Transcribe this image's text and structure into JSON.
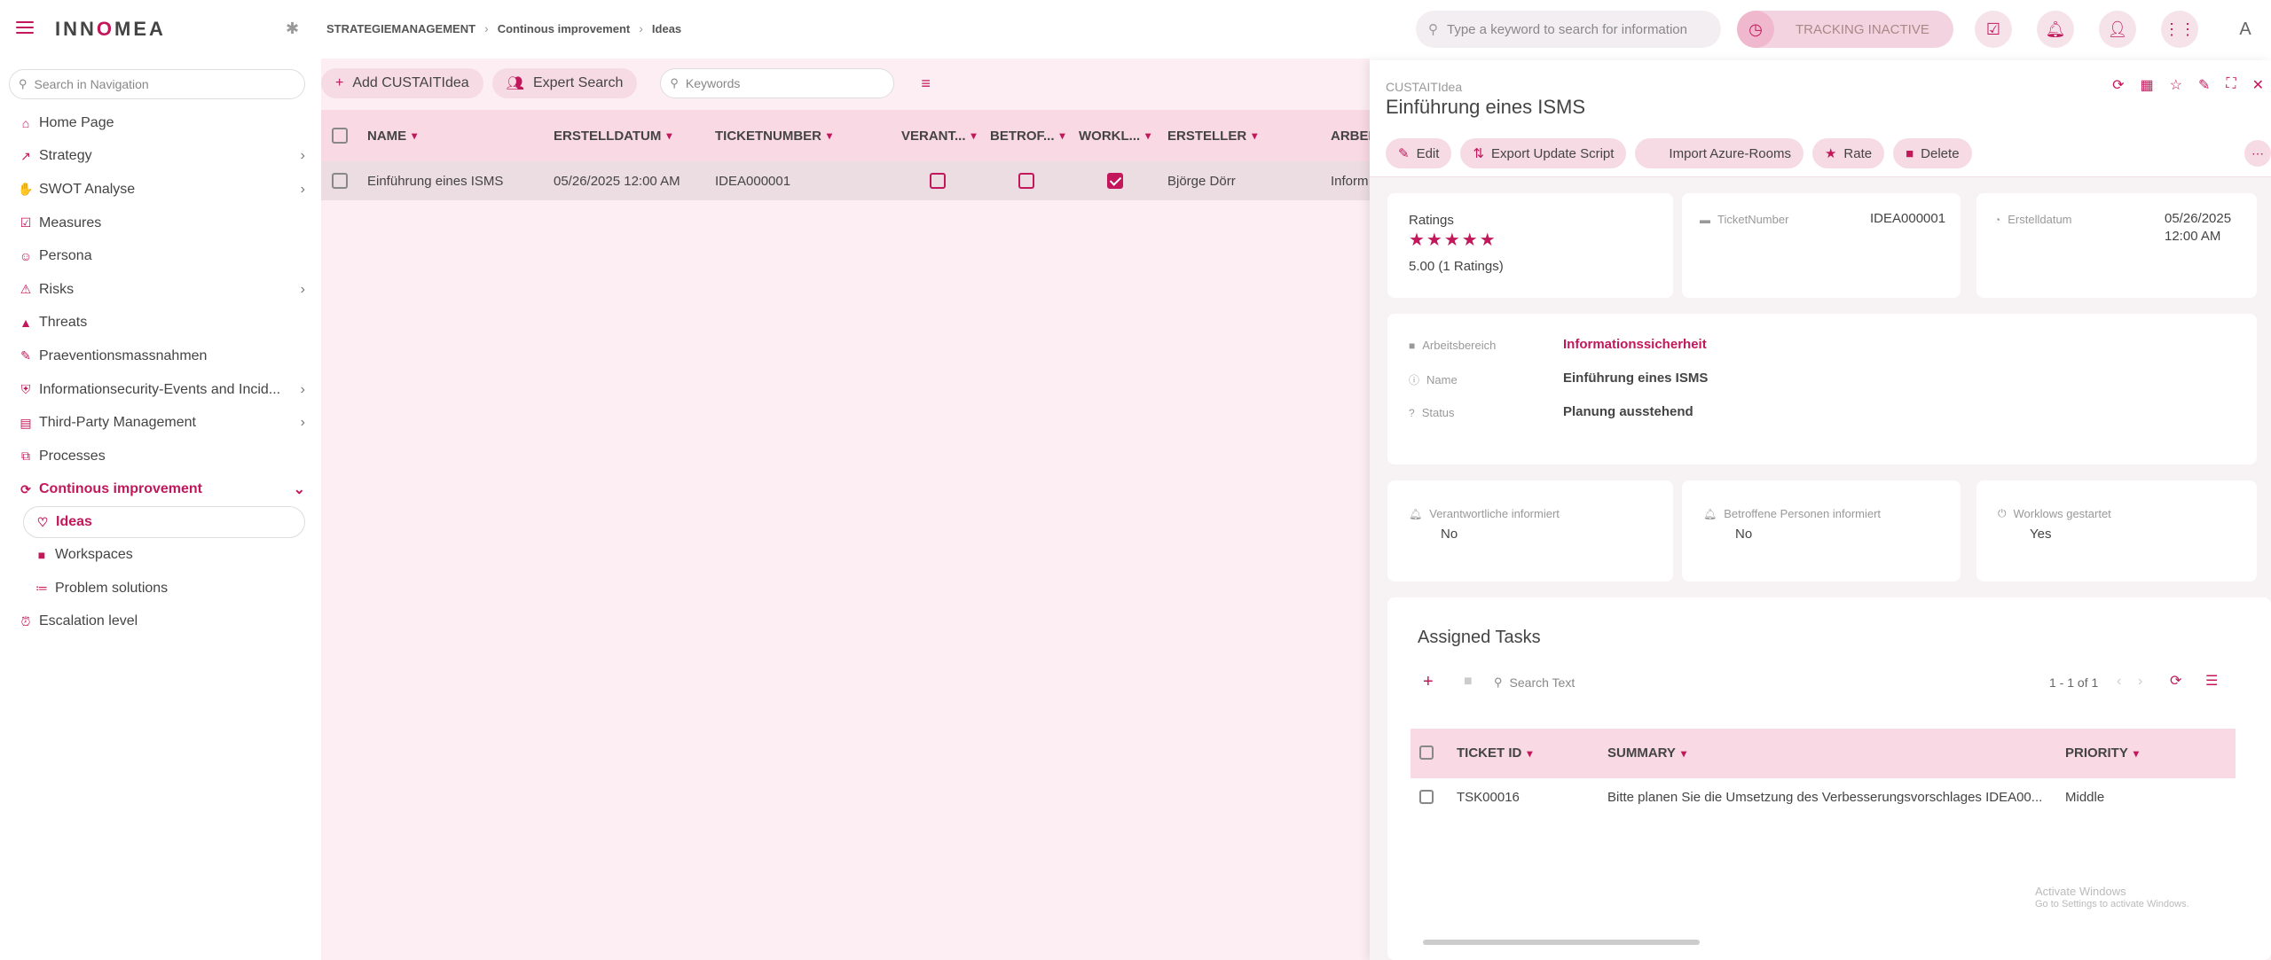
{
  "header": {
    "logo": "INNOMEA",
    "breadcrumb": [
      "STRATEGIEMANAGEMENT",
      "Continous improvement",
      "Ideas"
    ],
    "search_placeholder": "Type a keyword to search for information",
    "tracking_label": "TRACKING INACTIVE",
    "avatar_letter": "A"
  },
  "sidebar": {
    "search_placeholder": "Search in Navigation",
    "items": [
      {
        "label": "Home Page",
        "icon": "home-icon",
        "chevron": false
      },
      {
        "label": "Strategy",
        "icon": "trend-icon",
        "chevron": true
      },
      {
        "label": "SWOT Analyse",
        "icon": "swot-icon",
        "chevron": true
      },
      {
        "label": "Measures",
        "icon": "check-box-icon",
        "chevron": false
      },
      {
        "label": "Persona",
        "icon": "person-icon",
        "chevron": false
      },
      {
        "label": "Risks",
        "icon": "warning-icon",
        "chevron": true
      },
      {
        "label": "Threats",
        "icon": "alert-icon",
        "chevron": false
      },
      {
        "label": "Praeventionsmassnahmen",
        "icon": "wrench-icon",
        "chevron": false
      },
      {
        "label": "Informationsecurity-Events and Incid...",
        "icon": "shield-icon",
        "chevron": true
      },
      {
        "label": "Third-Party Management",
        "icon": "building-icon",
        "chevron": true
      },
      {
        "label": "Processes",
        "icon": "process-icon",
        "chevron": false
      },
      {
        "label": "Continous improvement",
        "icon": "improve-icon",
        "chevron": true
      },
      {
        "label": "Ideas",
        "icon": "bulb-icon",
        "chevron": false
      },
      {
        "label": "Workspaces",
        "icon": "briefcase-icon",
        "chevron": false
      },
      {
        "label": "Problem solutions",
        "icon": "list-check-icon",
        "chevron": false
      },
      {
        "label": "Escalation level",
        "icon": "alarm-icon",
        "chevron": false
      }
    ]
  },
  "list": {
    "add_label": "Add CUSTAITIdea",
    "expert_label": "Expert Search",
    "keywords_placeholder": "Keywords",
    "columns": [
      "NAME",
      "ERSTELLDATUM",
      "TICKETNUMBER",
      "VERANT...",
      "BETROF...",
      "WORKL...",
      "ERSTELLER",
      "ARBEI"
    ],
    "rows": [
      {
        "name": "Einführung eines ISMS",
        "date": "05/26/2025 12:00 AM",
        "ticket": "IDEA000001",
        "verant": false,
        "betrof": false,
        "workl": true,
        "ersteller": "Björge Dörr",
        "arbei": "Inform"
      }
    ]
  },
  "panel": {
    "type": "CUSTAITIdea",
    "title": "Einführung eines ISMS",
    "actions": {
      "edit": "Edit",
      "export": "Export Update Script",
      "import": "Import Azure-Rooms",
      "rate": "Rate",
      "delete": "Delete"
    },
    "ratings_label": "Ratings",
    "stars": "★★★★★",
    "ratings_value": "5.00 (1 Ratings)",
    "ticket_label": "TicketNumber",
    "ticket_value": "IDEA000001",
    "date_label": "Erstelldatum",
    "date_value_1": "05/26/2025",
    "date_value_2": "12:00 AM",
    "arbeitsbereich_label": "Arbeitsbereich",
    "arbeitsbereich_value": "Informationssicherheit",
    "name_label": "Name",
    "name_value": "Einführung eines ISMS",
    "status_label": "Status",
    "status_value": "Planung ausstehend",
    "verant_label": "Verantwortliche informiert",
    "verant_value": "No",
    "betrof_label": "Betroffene Personen informiert",
    "betrof_value": "No",
    "workflows_label": "Worklows gestartet",
    "workflows_value": "Yes",
    "tasks": {
      "title": "Assigned Tasks",
      "search_placeholder": "Search Text",
      "pagination": "1 - 1 of 1",
      "columns": [
        "TICKET ID",
        "SUMMARY",
        "PRIORITY"
      ],
      "rows": [
        {
          "id": "TSK00016",
          "summary": "Bitte planen Sie die Umsetzung des Verbesserungsvorschlages IDEA00...",
          "priority": "Middle"
        }
      ]
    },
    "watermark_1": "Activate Windows",
    "watermark_2": "Go to Settings to activate Windows."
  }
}
